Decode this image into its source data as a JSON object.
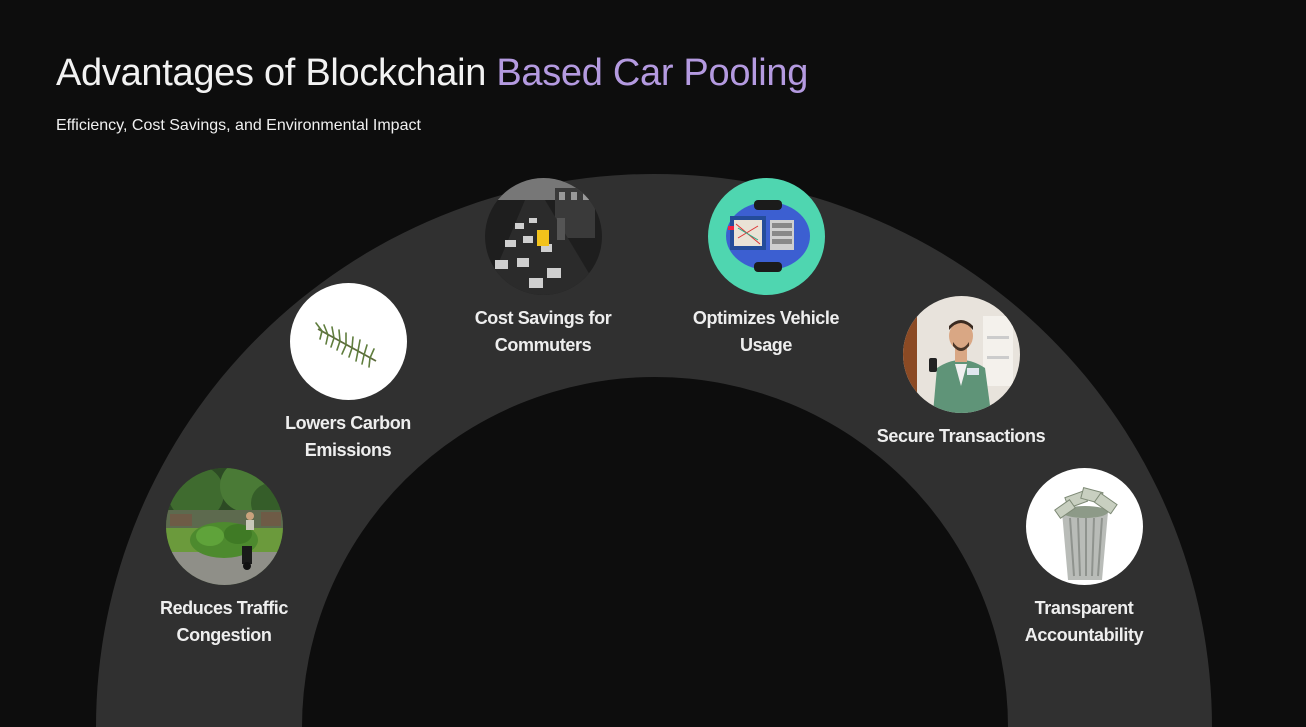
{
  "slide": {
    "title_main": "Advantages of Blockchain ",
    "title_accent": "Based Car Pooling",
    "subtitle": "Efficiency, Cost Savings, and Environmental Impact"
  },
  "colors": {
    "background": "#0d0d0d",
    "arc": "#303030",
    "title_accent": "#b49ae0",
    "text": "#eeeeee"
  },
  "items": [
    {
      "icon": "traffic-motorbike-image",
      "label_line1": "Reduces Traffic",
      "label_line2": "Congestion"
    },
    {
      "icon": "rosemary-sprig-image",
      "label_line1": "Lowers Carbon",
      "label_line2": "Emissions"
    },
    {
      "icon": "city-traffic-image",
      "label_line1": "Cost Savings for",
      "label_line2": "Commuters"
    },
    {
      "icon": "robot-car-kit-image",
      "label_line1": "Optimizes Vehicle",
      "label_line2": "Usage"
    },
    {
      "icon": "businessman-phone-image",
      "label_line1": "Secure Transactions",
      "label_line2": ""
    },
    {
      "icon": "money-bin-image",
      "label_line1": "Transparent",
      "label_line2": "Accountability"
    }
  ]
}
